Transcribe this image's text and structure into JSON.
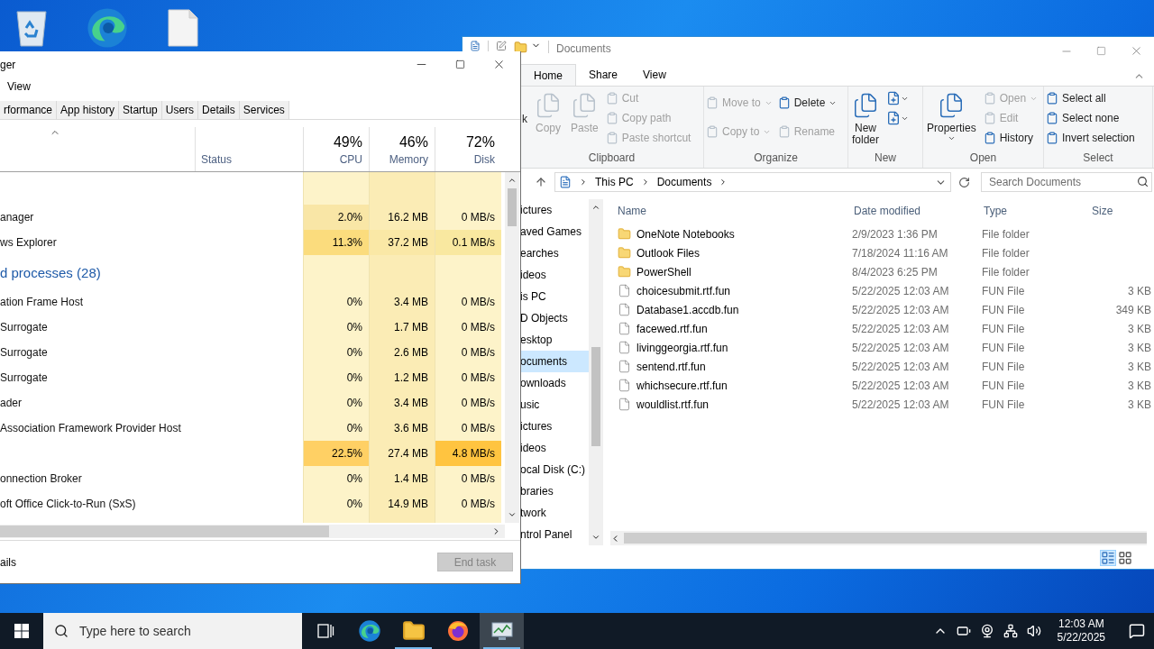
{
  "desktop": {
    "icons": [
      {
        "kind": "recycle-bin"
      },
      {
        "kind": "browser"
      },
      {
        "kind": "file"
      }
    ]
  },
  "explorer": {
    "title": "Documents",
    "ribbon_tabs": [
      {
        "label": "Home",
        "selected": true
      },
      {
        "label": "Share",
        "selected": false
      },
      {
        "label": "View",
        "selected": false
      }
    ],
    "ribbon_groups": [
      {
        "label": "Clipboard",
        "items": [
          {
            "label": "k",
            "kind": "fragment"
          },
          {
            "label": "Copy",
            "kind": "large",
            "disabled": true,
            "menu": false
          },
          {
            "label": "Paste",
            "kind": "large",
            "disabled": true,
            "menu": false
          },
          {
            "label": "Cut",
            "kind": "small",
            "disabled": true,
            "menu": false
          },
          {
            "label": "Copy path",
            "kind": "small",
            "disabled": true,
            "menu": false
          },
          {
            "label": "Paste shortcut",
            "kind": "small",
            "disabled": true,
            "menu": false
          }
        ]
      },
      {
        "label": "Organize",
        "items": [
          {
            "label": "Move to",
            "kind": "small",
            "disabled": true,
            "menu": true
          },
          {
            "label": "Copy to",
            "kind": "small",
            "disabled": true,
            "menu": true
          },
          {
            "label": "Delete",
            "kind": "small",
            "disabled": false,
            "menu": true
          },
          {
            "label": "Rename",
            "kind": "small",
            "disabled": true,
            "menu": false
          }
        ]
      },
      {
        "label": "New",
        "items": [
          {
            "label": "New folder",
            "kind": "large",
            "disabled": false,
            "menu": false
          },
          {
            "kind": "icon",
            "disabled": false,
            "menu": true
          },
          {
            "kind": "icon",
            "disabled": false,
            "menu": true
          }
        ]
      },
      {
        "label": "Open",
        "items": [
          {
            "label": "Properties",
            "kind": "large",
            "disabled": false,
            "menu": true
          },
          {
            "label": "Open",
            "kind": "small",
            "disabled": true,
            "menu": true
          },
          {
            "label": "Edit",
            "kind": "small",
            "disabled": true,
            "menu": false
          },
          {
            "label": "History",
            "kind": "small",
            "disabled": false,
            "menu": false
          }
        ]
      },
      {
        "label": "Select",
        "items": [
          {
            "label": "Select all",
            "kind": "small",
            "disabled": false,
            "menu": false
          },
          {
            "label": "Select none",
            "kind": "small",
            "disabled": false,
            "menu": false
          },
          {
            "label": "Invert selection",
            "kind": "small",
            "disabled": false,
            "menu": false
          }
        ]
      }
    ],
    "address": [
      "This PC",
      "Documents"
    ],
    "search": {
      "placeholder": "Search Documents"
    },
    "nav_items": [
      {
        "label": "ictures",
        "selected": false
      },
      {
        "label": "aved Games",
        "selected": false
      },
      {
        "label": "earches",
        "selected": false
      },
      {
        "label": "ideos",
        "selected": false
      },
      {
        "label": "is PC",
        "selected": false
      },
      {
        "label": "D Objects",
        "selected": false
      },
      {
        "label": "esktop",
        "selected": false
      },
      {
        "label": "ocuments",
        "selected": true
      },
      {
        "label": "ownloads",
        "selected": false
      },
      {
        "label": "usic",
        "selected": false
      },
      {
        "label": "ictures",
        "selected": false
      },
      {
        "label": "ideos",
        "selected": false
      },
      {
        "label": "ocal Disk (C:)",
        "selected": false
      },
      {
        "label": "braries",
        "selected": false
      },
      {
        "label": "twork",
        "selected": false
      },
      {
        "label": "ntrol Panel",
        "selected": false
      }
    ],
    "columns": [
      "Name",
      "Date modified",
      "Type",
      "Size"
    ],
    "files": [
      {
        "kind": "folder",
        "name": "OneNote Notebooks",
        "date": "2/9/2023 1:36 PM",
        "type": "File folder"
      },
      {
        "kind": "folder",
        "name": "Outlook Files",
        "date": "7/18/2024 11:16 AM",
        "type": "File folder"
      },
      {
        "kind": "folder",
        "name": "PowerShell",
        "date": "8/4/2023 6:25 PM",
        "type": "File folder"
      },
      {
        "kind": "file",
        "name": "choicesubmit.rtf.fun",
        "date": "5/22/2025 12:03 AM",
        "type": "FUN File",
        "size": "3 KB"
      },
      {
        "kind": "file",
        "name": "Database1.accdb.fun",
        "date": "5/22/2025 12:03 AM",
        "type": "FUN File",
        "size": "349 KB"
      },
      {
        "kind": "file",
        "name": "facewed.rtf.fun",
        "date": "5/22/2025 12:03 AM",
        "type": "FUN File",
        "size": "3 KB"
      },
      {
        "kind": "file",
        "name": "livinggeorgia.rtf.fun",
        "date": "5/22/2025 12:03 AM",
        "type": "FUN File",
        "size": "3 KB"
      },
      {
        "kind": "file",
        "name": "sentend.rtf.fun",
        "date": "5/22/2025 12:03 AM",
        "type": "FUN File",
        "size": "3 KB"
      },
      {
        "kind": "file",
        "name": "whichsecure.rtf.fun",
        "date": "5/22/2025 12:03 AM",
        "type": "FUN File",
        "size": "3 KB"
      },
      {
        "kind": "file",
        "name": "wouldlist.rtf.fun",
        "date": "5/22/2025 12:03 AM",
        "type": "FUN File",
        "size": "3 KB"
      }
    ]
  },
  "task_manager": {
    "title": "ger",
    "menu": [
      "View"
    ],
    "tabs": [
      {
        "label": "rformance",
        "selected": false
      },
      {
        "label": "App history",
        "selected": false
      },
      {
        "label": "Startup",
        "selected": false
      },
      {
        "label": "Users",
        "selected": false
      },
      {
        "label": "Details",
        "selected": false
      },
      {
        "label": "Services",
        "selected": false
      }
    ],
    "status_header": "Status",
    "summary": [
      {
        "percent": "49%",
        "label": "CPU"
      },
      {
        "percent": "46%",
        "label": "Memory"
      },
      {
        "percent": "72%",
        "label": "Disk"
      }
    ],
    "rows": [
      {
        "kind": "group"
      },
      {
        "kind": "process",
        "name": "anager",
        "cells": [
          {
            "text": "2.0%",
            "color": "#f9e6a6"
          },
          {
            "text": "16.2 MB",
            "color": "#fbecb5"
          },
          {
            "text": "0 MB/s",
            "color": "#fdf3c9"
          }
        ]
      },
      {
        "kind": "process",
        "name": "ws Explorer",
        "cells": [
          {
            "text": "11.3%",
            "color": "#fbdc7d"
          },
          {
            "text": "37.2 MB",
            "color": "#fae8a6"
          },
          {
            "text": "0.1 MB/s",
            "color": "#f9e8a0"
          }
        ]
      },
      {
        "kind": "group",
        "name": "d processes (28)"
      },
      {
        "kind": "process",
        "name": "ation Frame Host",
        "cells": [
          {
            "text": "0%",
            "color": "#fdf3c9"
          },
          {
            "text": "3.4 MB",
            "color": "#fbecb5"
          },
          {
            "text": "0 MB/s",
            "color": "#fdf3c9"
          }
        ]
      },
      {
        "kind": "process",
        "name": "Surrogate",
        "cells": [
          {
            "text": "0%",
            "color": "#fdf3c9"
          },
          {
            "text": "1.7 MB",
            "color": "#fbecb5"
          },
          {
            "text": "0 MB/s",
            "color": "#fdf3c9"
          }
        ]
      },
      {
        "kind": "process",
        "name": "Surrogate",
        "cells": [
          {
            "text": "0%",
            "color": "#fdf3c9"
          },
          {
            "text": "2.6 MB",
            "color": "#fbecb5"
          },
          {
            "text": "0 MB/s",
            "color": "#fdf3c9"
          }
        ]
      },
      {
        "kind": "process",
        "name": "Surrogate",
        "cells": [
          {
            "text": "0%",
            "color": "#fdf3c9"
          },
          {
            "text": "1.2 MB",
            "color": "#fbecb5"
          },
          {
            "text": "0 MB/s",
            "color": "#fdf3c9"
          }
        ]
      },
      {
        "kind": "process",
        "name": "ader",
        "cells": [
          {
            "text": "0%",
            "color": "#fdf3c9"
          },
          {
            "text": "3.4 MB",
            "color": "#fbecb5"
          },
          {
            "text": "0 MB/s",
            "color": "#fdf3c9"
          }
        ]
      },
      {
        "kind": "process",
        "name": "Association Framework Provider Host",
        "cells": [
          {
            "text": "0%",
            "color": "#fdf3c9"
          },
          {
            "text": "3.6 MB",
            "color": "#fbecb5"
          },
          {
            "text": "0 MB/s",
            "color": "#fdf3c9"
          }
        ]
      },
      {
        "kind": "process",
        "cells": [
          {
            "text": "22.5%",
            "color": "#ffd064"
          },
          {
            "text": "27.4 MB",
            "color": "#fbecb5"
          },
          {
            "text": "4.8 MB/s",
            "color": "#ffc440"
          }
        ]
      },
      {
        "kind": "process",
        "name": "onnection Broker",
        "cells": [
          {
            "text": "0%",
            "color": "#fdf3c9"
          },
          {
            "text": "1.4 MB",
            "color": "#fbecb5"
          },
          {
            "text": "0 MB/s",
            "color": "#fdf3c9"
          }
        ]
      },
      {
        "kind": "process",
        "name": "oft Office Click-to-Run (SxS)",
        "cells": [
          {
            "text": "0%",
            "color": "#fdf3c9"
          },
          {
            "text": "14.9 MB",
            "color": "#fbecb5"
          },
          {
            "text": "0 MB/s",
            "color": "#fdf3c9"
          }
        ]
      }
    ],
    "details_link": "ails",
    "end_task": {
      "label": "End task",
      "disabled": true
    }
  },
  "taskbar": {
    "search_placeholder": "Type here to search",
    "apps": [
      {
        "kind": "task-view",
        "running": false,
        "active": false
      },
      {
        "kind": "browser",
        "running": false,
        "active": false
      },
      {
        "kind": "folder",
        "running": true,
        "active": false
      },
      {
        "kind": "firefox",
        "running": false,
        "active": false
      },
      {
        "kind": "task-manager",
        "running": true,
        "active": true
      }
    ],
    "time": "12:03 AM",
    "date": "5/22/2025"
  }
}
